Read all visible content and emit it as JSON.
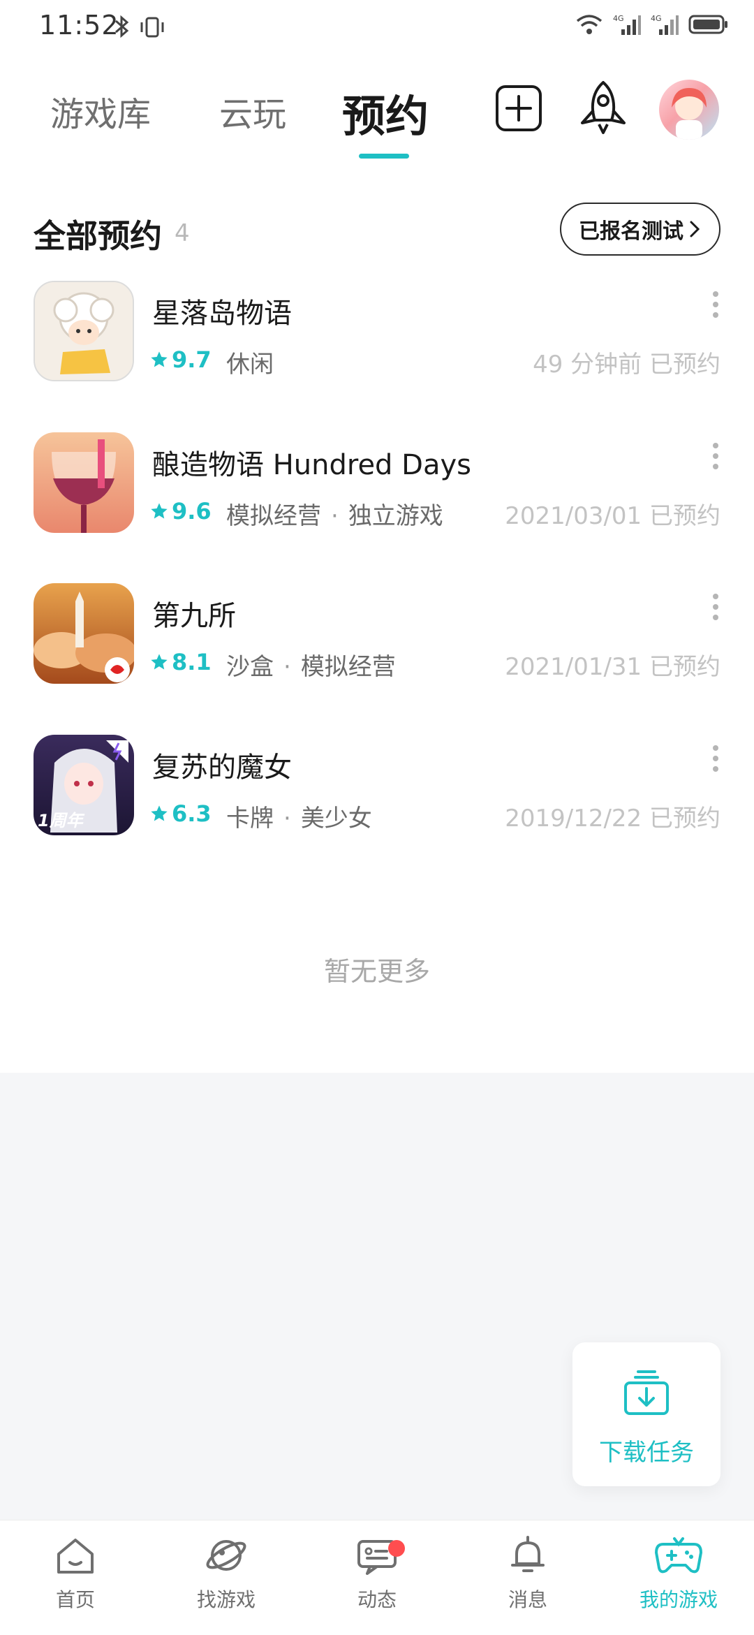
{
  "status_bar": {
    "time": "11:52",
    "network_1": "4G",
    "network_2": "4G"
  },
  "top_tabs": [
    {
      "label": "游戏库",
      "active": false
    },
    {
      "label": "云玩",
      "active": false
    },
    {
      "label": "预约",
      "active": true
    }
  ],
  "section": {
    "title": "全部预约",
    "count": "4",
    "signed_button": "已报名测试"
  },
  "games": [
    {
      "name": "星落岛物语",
      "rating": "9.7",
      "tags": [
        "休闲"
      ],
      "meta": "49 分钟前 已预约"
    },
    {
      "name": "酿造物语 Hundred Days",
      "rating": "9.6",
      "tags": [
        "模拟经营",
        "独立游戏"
      ],
      "meta": "2021/03/01 已预约"
    },
    {
      "name": "第九所",
      "rating": "8.1",
      "tags": [
        "沙盒",
        "模拟经营"
      ],
      "meta": "2021/01/31 已预约"
    },
    {
      "name": "复苏的魔女",
      "rating": "6.3",
      "tags": [
        "卡牌",
        "美少女"
      ],
      "meta": "2019/12/22 已预约",
      "icon_badge": "1周年"
    }
  ],
  "no_more": "暂无更多",
  "download_card": {
    "label": "下载任务"
  },
  "bottom_nav": [
    {
      "label": "首页",
      "icon": "home-icon"
    },
    {
      "label": "找游戏",
      "icon": "planet-icon"
    },
    {
      "label": "动态",
      "icon": "chat-icon",
      "badge": true
    },
    {
      "label": "消息",
      "icon": "bell-icon"
    },
    {
      "label": "我的游戏",
      "icon": "gamepad-icon",
      "active": true
    }
  ],
  "colors": {
    "accent": "#1ebfc4",
    "badge": "#ff4d4f",
    "background_grey": "#f5f6f8"
  }
}
